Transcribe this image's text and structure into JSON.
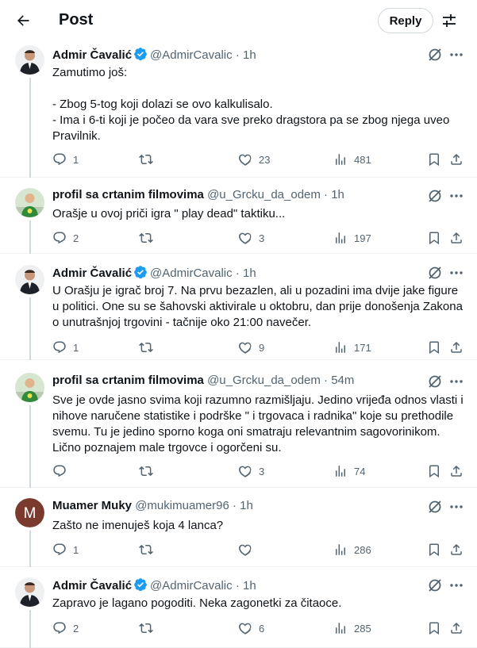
{
  "header": {
    "title": "Post",
    "reply_button": "Reply"
  },
  "posts": [
    {
      "name": "Admir Čavalić",
      "verified": true,
      "handle": "@AdmirCavalic",
      "time": "· 1h",
      "text": "Zamutimo još:\n\n- Zbog 5-tog koji dolazi se ovo kalkulisalo.\n- Ima i 6-ti koji je počeo da vara sve preko dragstora pa se zbog njega uveo Pravilnik.",
      "replies": "1",
      "reposts": "",
      "likes": "23",
      "views": "481"
    },
    {
      "name": "profil sa crtanim filmovima",
      "verified": false,
      "handle": "@u_Grcku_da_odem",
      "time": "· 1h",
      "text": "Orašje u ovoj priči igra \" play dead\" taktiku...",
      "replies": "2",
      "reposts": "",
      "likes": "3",
      "views": "197"
    },
    {
      "name": "Admir Čavalić",
      "verified": true,
      "handle": "@AdmirCavalic",
      "time": "· 1h",
      "text": "U Orašju je igrač broj 7. Na prvu bezazlen, ali u pozadini ima dvije jake figure u politici. One su se šahovski aktivirale u oktobru, dan prije donošenja Zakona o unutrašnjoj trgovini - tačnije oko 21:00 navečer.",
      "replies": "1",
      "reposts": "",
      "likes": "9",
      "views": "171"
    },
    {
      "name": "profil sa crtanim filmovima",
      "verified": false,
      "handle": "@u_Grcku_da_odem",
      "time": "· 54m",
      "text": "Sve je ovde jasno svima koji razumno razmišljaju. Jedino vrijeđa odnos vlasti i nihove naručene statistike i podrške \" i trgovaca i radnika\" koje su prethodile svemu. Tu je jedino sporno koga oni smatraju relevantnim sagovorinikom. Lično poznajem male trgovce i ogorčeni su.",
      "replies": "",
      "reposts": "",
      "likes": "3",
      "views": "74"
    },
    {
      "name": "Muamer Muky",
      "verified": false,
      "handle": "@mukimuamer96",
      "time": "· 1h",
      "avatar_letter": "M",
      "text": "Zašto ne imenuješ koja 4 lanca?",
      "replies": "1",
      "reposts": "",
      "likes": "",
      "views": "286"
    },
    {
      "name": "Admir Čavalić",
      "verified": true,
      "handle": "@AdmirCavalic",
      "time": "· 1h",
      "text": "Zapravo je lagano pogoditi. Neka zagonetki za čitaoce.",
      "replies": "2",
      "reposts": "",
      "likes": "6",
      "views": "285"
    }
  ],
  "colors": {
    "accent": "#1d9bf0",
    "muted": "#536471",
    "border": "#eff3f4",
    "muamer_avatar": "#7a3b2e"
  }
}
